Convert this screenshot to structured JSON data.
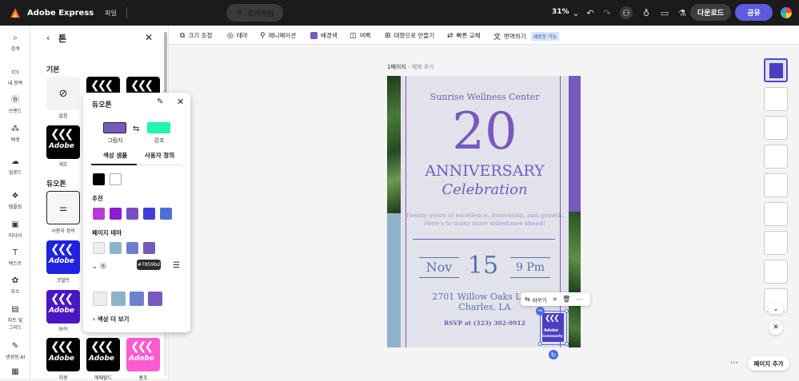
{
  "topbar": {
    "app_name": "Adobe Express",
    "file_menu": "파일",
    "premium_label": "프리미엄",
    "zoom": "31%",
    "download_label": "다운로드",
    "share_label": "공유"
  },
  "leftrail": {
    "items": [
      {
        "label": "검색",
        "icon": "search-icon"
      },
      {
        "label": "내 항목",
        "icon": "folder-icon"
      },
      {
        "label": "브랜드",
        "icon": "brand-icon"
      },
      {
        "label": "에셋",
        "icon": "assets-icon"
      },
      {
        "label": "업로드",
        "icon": "upload-icon"
      },
      {
        "label": "템플릿",
        "icon": "template-icon"
      },
      {
        "label": "미디어",
        "icon": "media-icon"
      },
      {
        "label": "텍스트",
        "icon": "text-icon"
      },
      {
        "label": "요소",
        "icon": "elements-icon"
      },
      {
        "label": "차트 및",
        "label2": "그리드",
        "icon": "chart-icon"
      },
      {
        "label": "생성형 AI",
        "icon": "ai-icon"
      }
    ]
  },
  "panel": {
    "title": "톤",
    "section_basic": "기본",
    "section_duotone": "듀오톤",
    "tiles": {
      "none_label": "없음",
      "sepia_label": "세조",
      "custom_label": "사용자 정의",
      "cobalt_label": "코발트",
      "violet_label": "보라",
      "bottom1_label": "지콩",
      "bottom2_label": "에메랄드",
      "bottom3_label": "홍조"
    },
    "logo_line1": "Adobe",
    "logo_line2": "Community"
  },
  "popover": {
    "title": "듀오톤",
    "shadow_label": "그림자",
    "highlight_label": "강조",
    "shadow_color": "#7859bd",
    "highlight_color": "#21f5b0",
    "tab_samples": "색상 샘플",
    "tab_custom": "사용자 정의",
    "basic_swatches": [
      "#000000",
      "#ffffff"
    ],
    "recommended_label": "추천",
    "recommended_swatches": [
      "#b63cd4",
      "#8b1bd6",
      "#7b4fc2",
      "#3f3fd6",
      "#4f6fd0"
    ],
    "page_theme_label": "페이지 테마",
    "theme_swatches": [
      "#eeeeee",
      "#8fb2cb",
      "#6f7fd0",
      "#7859bd"
    ],
    "tooltip": "#7859bd",
    "brand_swatches": [
      "#eeeeee",
      "#8fb2cb",
      "#6f7fd0",
      "#7859bd"
    ],
    "more_colors": "색상 더 보기"
  },
  "toolbar": {
    "items": [
      {
        "label": "크기 조정",
        "icon": "resize-icon"
      },
      {
        "label": "테마",
        "icon": "theme-icon"
      },
      {
        "label": "애니메이션",
        "icon": "animation-icon"
      },
      {
        "label": "배경색",
        "icon": "background-color-icon"
      },
      {
        "label": "여백",
        "icon": "margin-icon"
      },
      {
        "label": "대량으로 만들기",
        "icon": "bulk-create-icon"
      },
      {
        "label": "빠른 교체",
        "icon": "quick-swap-icon"
      },
      {
        "label": "번역하기",
        "icon": "translate-icon"
      }
    ],
    "new_badge": "새로운 기능"
  },
  "canvas": {
    "page_label": "1페이지",
    "page_sub": " - 제목 추가",
    "org": "Sunrise Wellness Center",
    "number": "20",
    "anniversary": "ANNIVERSARY",
    "celebration": "Celebration",
    "tagline1": "Twenty years of excellence, innovation, and growth.",
    "tagline2": "Here's to many more milestones ahead!",
    "month": "Nov",
    "day": "15",
    "time": "9 Pm",
    "address1": "2701 Willow Oaks Lane",
    "address2": "Charles, LA",
    "rsvp": "RSVP at (323) 302-9912",
    "float_replace": "바꾸기"
  },
  "pages": {
    "add_page": "페이지 추가"
  }
}
